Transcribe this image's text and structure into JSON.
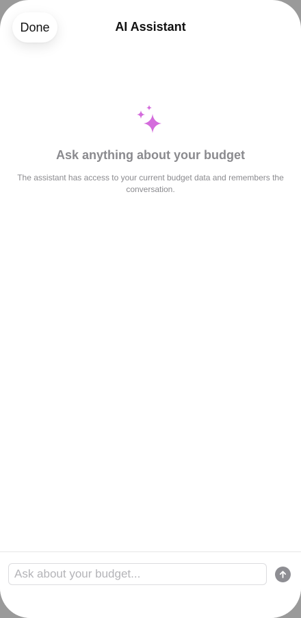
{
  "nav": {
    "done_label": "Done",
    "title": "AI Assistant"
  },
  "empty_state": {
    "icon": "sparkles-icon",
    "title": "Ask anything about your budget",
    "subtitle": "The assistant has access to your current budget data and remembers the conversation."
  },
  "composer": {
    "value": "",
    "placeholder": "Ask about your budget...",
    "send_icon": "arrow-up-icon"
  },
  "colors": {
    "accent": "#d46cdc",
    "muted_text": "#8a8a8e",
    "send_button": "#8e8e93"
  }
}
